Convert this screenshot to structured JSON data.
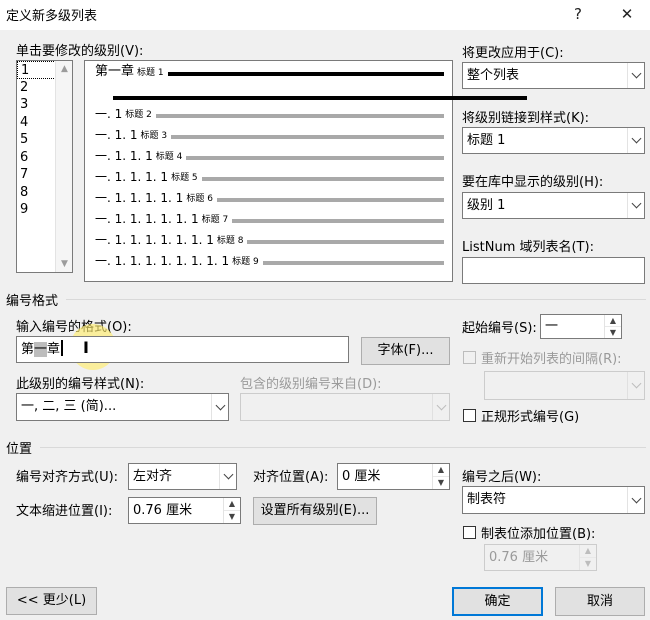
{
  "window": {
    "title": "定义新多级列表",
    "help_glyph": "?",
    "close_glyph": "✕"
  },
  "levels": {
    "label": "单击要修改的级别(V):",
    "items": [
      "1",
      "2",
      "3",
      "4",
      "5",
      "6",
      "7",
      "8",
      "9"
    ],
    "selected": "1"
  },
  "preview": {
    "rows": [
      {
        "num": "第一章",
        "heading": "标题 1"
      },
      {
        "num": "一. 1",
        "heading": "标题 2"
      },
      {
        "num": "一. 1. 1",
        "heading": "标题 3"
      },
      {
        "num": "一. 1. 1. 1",
        "heading": "标题 4"
      },
      {
        "num": "一. 1. 1. 1. 1",
        "heading": "标题 5"
      },
      {
        "num": "一. 1. 1. 1. 1. 1",
        "heading": "标题 6"
      },
      {
        "num": "一. 1. 1. 1. 1. 1. 1",
        "heading": "标题 7"
      },
      {
        "num": "一. 1. 1. 1. 1. 1. 1. 1",
        "heading": "标题 8"
      },
      {
        "num": "一. 1. 1. 1. 1. 1. 1. 1. 1",
        "heading": "标题 9"
      }
    ]
  },
  "apply_to": {
    "label": "将更改应用于(C):",
    "value": "整个列表"
  },
  "link_style": {
    "label": "将级别链接到样式(K):",
    "value": "标题 1"
  },
  "gallery_level": {
    "label": "要在库中显示的级别(H):",
    "value": "级别 1"
  },
  "listnum": {
    "label": "ListNum 域列表名(T):",
    "value": ""
  },
  "number_format": {
    "section": "编号格式",
    "format_label": "输入编号的格式(O):",
    "format_before": "第",
    "format_selected": "一",
    "format_after": "章",
    "font_button": "字体(F)...",
    "style_label": "此级别的编号样式(N):",
    "style_value": "一, 二, 三 (简)...",
    "include_label": "包含的级别编号来自(D):",
    "include_value": "",
    "start_label": "起始编号(S):",
    "start_value": "一",
    "restart_label": "重新开始列表的间隔(R):",
    "restart_value": "",
    "legal_label": "正规形式编号(G)"
  },
  "position": {
    "section": "位置",
    "align_label": "编号对齐方式(U):",
    "align_value": "左对齐",
    "align_at_label": "对齐位置(A):",
    "align_at_value": "0 厘米",
    "indent_label": "文本缩进位置(I):",
    "indent_value": "0.76 厘米",
    "set_all_button": "设置所有级别(E)...",
    "follow_label": "编号之后(W):",
    "follow_value": "制表符",
    "tab_add_label": "制表位添加位置(B):",
    "tab_add_value": "0.76 厘米"
  },
  "footer": {
    "less_button": "<< 更少(L)",
    "ok_button": "确定",
    "cancel_button": "取消"
  }
}
